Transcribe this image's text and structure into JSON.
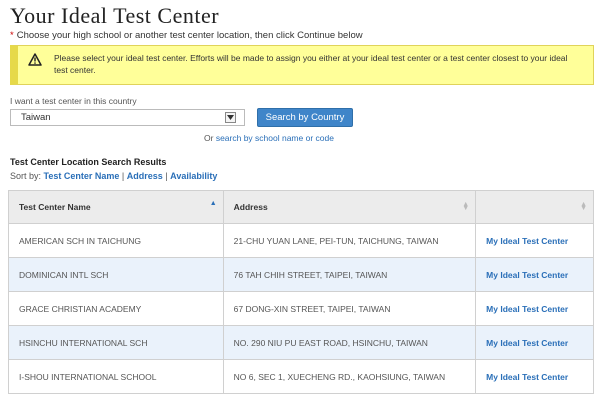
{
  "page": {
    "title": "Your Ideal Test Center",
    "instruction": "Choose your high school or another test center location, then click Continue below",
    "alert": "Please select your ideal test center. Efforts will be made to assign you either at your ideal test center or a test center closest to your ideal test center."
  },
  "search": {
    "country_label": "I want a test center in this country",
    "selected_country": "Taiwan",
    "button_label": "Search by Country",
    "or_text": "Or",
    "alt_link": "search by school name or code"
  },
  "results": {
    "heading": "Test Center Location Search Results",
    "sort_label": "Sort by:",
    "sort_options": [
      "Test Center Name",
      "Address",
      "Availability"
    ],
    "separator": "|",
    "columns": [
      "Test Center Name",
      "Address",
      ""
    ],
    "rows": [
      {
        "name": "AMERICAN SCH IN TAICHUNG",
        "address": "21-CHU YUAN LANE, PEI-TUN, TAICHUNG, TAIWAN",
        "action": "My Ideal Test Center"
      },
      {
        "name": "DOMINICAN INTL SCH",
        "address": "76 TAH CHIH STREET, TAIPEI, TAIWAN",
        "action": "My Ideal Test Center"
      },
      {
        "name": "GRACE CHRISTIAN ACADEMY",
        "address": "67 DONG-XIN STREET, TAIPEI, TAIWAN",
        "action": "My Ideal Test Center"
      },
      {
        "name": "HSINCHU INTERNATIONAL SCH",
        "address": "NO. 290 NIU PU EAST ROAD, HSINCHU, TAIWAN",
        "action": "My Ideal Test Center"
      },
      {
        "name": "I-SHOU INTERNATIONAL SCHOOL",
        "address": "NO 6, SEC 1, XUECHENG RD., KAOHSIUNG, TAIWAN",
        "action": "My Ideal Test Center"
      }
    ]
  },
  "colors": {
    "link": "#2a6fb8",
    "button": "#3f85c9",
    "alert_bg": "#ffff99",
    "row_alt": "#eaf2fb"
  },
  "icons": {
    "alert": "warning-icon",
    "dropdown": "dropdown-arrow-icon",
    "sort": "sort-icon"
  }
}
